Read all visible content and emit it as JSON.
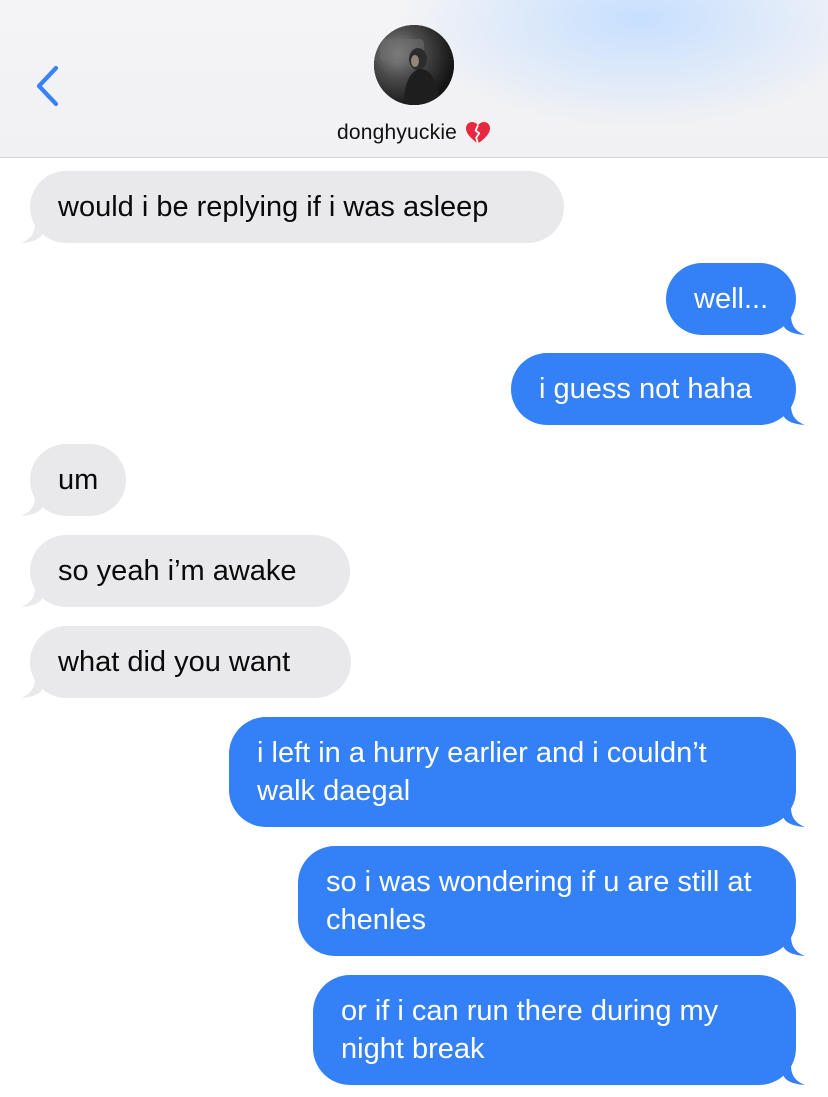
{
  "header": {
    "back_icon": "chevron-left-icon",
    "contact_name": "donghyuckie",
    "contact_emoji_icon": "broken-heart-icon",
    "avatar_icon": "contact-avatar-photo"
  },
  "colors": {
    "incoming_bubble": "#e9e9eb",
    "outgoing_bubble": "#3480f7",
    "accent": "#3a82f7",
    "heart": "#e8283e"
  },
  "messages": [
    {
      "direction": "incoming",
      "text": "would i be replying if i was asleep"
    },
    {
      "direction": "outgoing",
      "text": "well..."
    },
    {
      "direction": "outgoing",
      "text": "i guess not haha"
    },
    {
      "direction": "incoming",
      "text": "um"
    },
    {
      "direction": "incoming",
      "text": "so yeah i’m awake"
    },
    {
      "direction": "incoming",
      "text": "what did you want"
    },
    {
      "direction": "outgoing",
      "text": "i left in a hurry earlier and i couldn’t walk daegal"
    },
    {
      "direction": "outgoing",
      "text": "so i was wondering if u are still at chenles"
    },
    {
      "direction": "outgoing",
      "text": "or if i can run there during my night break"
    }
  ]
}
